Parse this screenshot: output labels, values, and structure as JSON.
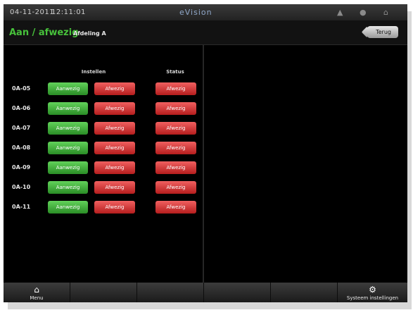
{
  "statusbar": {
    "date": "04-11-2011",
    "time": "12:11:01",
    "brand": "eVision",
    "icons": [
      "signal-icon",
      "info-icon",
      "home-icon"
    ]
  },
  "header": {
    "title": "Aan / afwezig",
    "subtitle": "Afdeling A",
    "back_label": "Terug"
  },
  "columns": {
    "instellen": "Instellen",
    "status": "Status"
  },
  "rows": [
    {
      "label": "0A-05",
      "present": "Aanwezig",
      "absent": "Afwezig",
      "status": "Afwezig"
    },
    {
      "label": "0A-06",
      "present": "Aanwezig",
      "absent": "Afwezig",
      "status": "Afwezig"
    },
    {
      "label": "0A-07",
      "present": "Aanwezig",
      "absent": "Afwezig",
      "status": "Afwezig"
    },
    {
      "label": "0A-08",
      "present": "Aanwezig",
      "absent": "Afwezig",
      "status": "Afwezig"
    },
    {
      "label": "0A-09",
      "present": "Aanwezig",
      "absent": "Afwezig",
      "status": "Afwezig"
    },
    {
      "label": "0A-10",
      "present": "Aanwezig",
      "absent": "Afwezig",
      "status": "Afwezig"
    },
    {
      "label": "0A-11",
      "present": "Aanwezig",
      "absent": "Afwezig",
      "status": "Afwezig"
    }
  ],
  "tabbar": {
    "menu_label": "Menu",
    "settings_label": "Systeem instellingen"
  },
  "colors": {
    "accent_green": "#47c13b",
    "button_green": "#3aa833",
    "button_red": "#d83a3a"
  }
}
